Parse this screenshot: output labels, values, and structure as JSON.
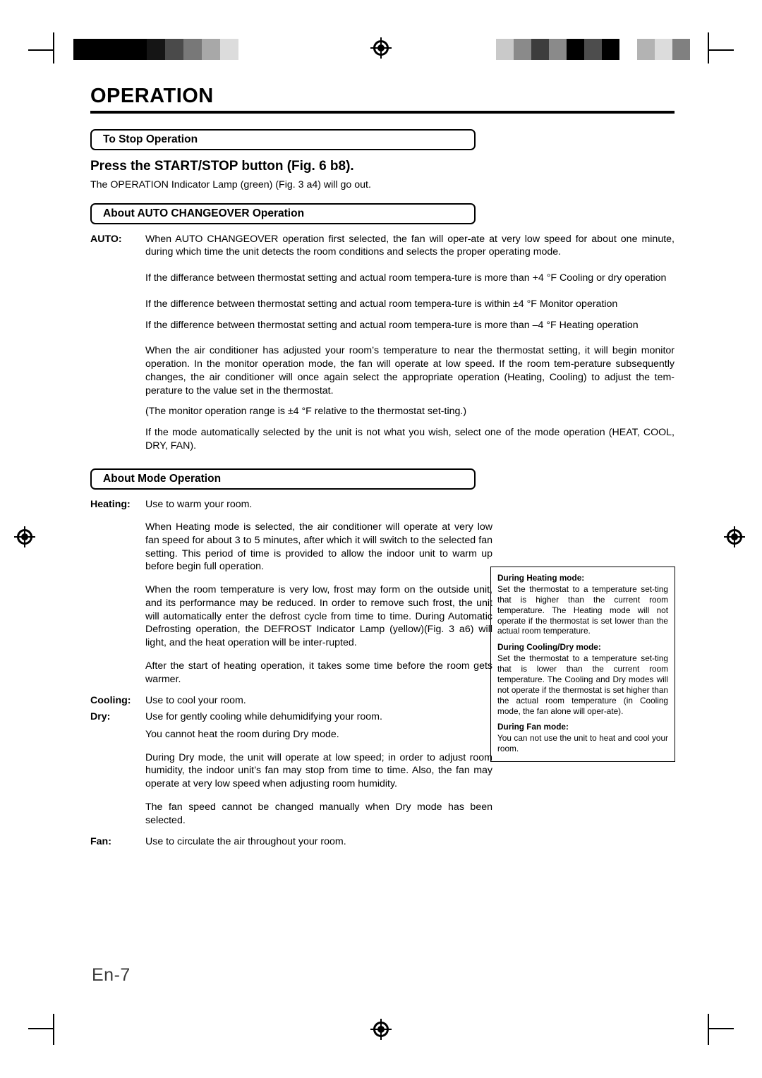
{
  "document": {
    "title": "OPERATION",
    "page_number": "En-7"
  },
  "sections": {
    "stop": {
      "heading": "To Stop Operation",
      "subheading": "Press the START/STOP button  (Fig. 6 b8).",
      "body": "The OPERATION Indicator Lamp (green) (Fig. 3 a4) will go out."
    },
    "auto_changeover": {
      "heading": "About AUTO CHANGEOVER Operation",
      "term": "AUTO:",
      "paragraphs": [
        "When AUTO CHANGEOVER operation first selected, the fan will oper-ate at very low speed for about one minute, during which time the unit detects the room conditions and selects the proper operating mode.",
        "If the differance between thermostat setting and actual room tempera-ture is more than +4 °F     Cooling or dry operation",
        "If the difference between thermostat setting and actual room tempera-ture is within ±4 °F     Monitor operation",
        "If the difference between thermostat setting and actual room tempera-ture is more than –4 °F     Heating operation",
        "When the air conditioner has adjusted your room’s temperature to near the thermostat setting, it will begin monitor operation. In the monitor operation mode, the fan will operate at low speed. If the room tem-perature subsequently changes, the air conditioner will once again select the appropriate operation (Heating, Cooling) to adjust the tem-perature to the value set in the thermostat.",
        "(The monitor operation range is ±4 °F relative to the thermostat set-ting.)",
        "If the mode automatically selected by the unit is not what you wish, select one of the mode operation (HEAT, COOL, DRY, FAN)."
      ]
    },
    "mode_operation": {
      "heading": "About Mode Operation",
      "entries": [
        {
          "term": "Heating:",
          "paragraphs": [
            "Use to warm your room.",
            "When Heating mode is selected, the air conditioner will operate at very low fan speed for about 3 to 5 minutes, after which it will switch to the selected fan setting. This period of time is provided to allow the indoor unit to warm up before begin full operation.",
            "When the room temperature is very low, frost may form on the outside unit, and its performance may be reduced. In order to remove such frost, the unit will automatically enter the defrost cycle from time to time. During Automatic Defrosting operation, the DEFROST Indicator Lamp (yellow)(Fig. 3 a6) will light, and the heat operation will be inter-rupted.",
            "After the start of heating operation, it takes some time before the room gets warmer."
          ]
        },
        {
          "term": "Cooling:",
          "paragraphs": [
            "Use to cool your room."
          ]
        },
        {
          "term": "Dry:",
          "paragraphs": [
            "Use for gently cooling while dehumidifying your room.",
            "You cannot heat the room during Dry mode.",
            "During Dry mode, the unit will operate at low speed; in order to adjust room humidity, the indoor unit’s fan may stop from time to time. Also, the fan may operate at very low speed when adjusting room humidity.",
            "The fan speed cannot be changed manually when Dry mode has been selected."
          ]
        },
        {
          "term": "Fan:",
          "paragraphs": [
            "Use to circulate the air throughout your room."
          ]
        }
      ]
    },
    "sidebox": {
      "items": [
        {
          "title": "During Heating mode:",
          "text": "Set the thermostat to a temperature set-ting that is higher than the current room temperature. The Heating mode will not operate if the thermostat is set lower than the actual room temperature."
        },
        {
          "title": "During Cooling/Dry mode:",
          "text": "Set the thermostat to a temperature set-ting that is lower than the current room temperature. The Cooling and Dry modes will not operate if the thermostat is set higher than the actual room temperature (in Cooling mode, the fan alone will oper-ate)."
        },
        {
          "title": "During Fan mode:",
          "text": "You can not use the unit to heat and cool your room."
        }
      ]
    }
  },
  "print_marks": {
    "left_colorbar": [
      "#000000",
      "#000000",
      "#000000",
      "#000000",
      "#1a1a1a",
      "#4d4d4d",
      "#7a7a7a",
      "#a6a6a6",
      "#d9d9d9",
      "#ffffff"
    ],
    "right_colorbar": [
      "#c9c9c9",
      "#8a8a8a",
      "#3d3d3d",
      "#8a8a8a",
      "#000000",
      "#4d4d4d",
      "#000000",
      "#ffffff",
      "#b3b3b3",
      "#d9d9d9",
      "#808080"
    ]
  }
}
